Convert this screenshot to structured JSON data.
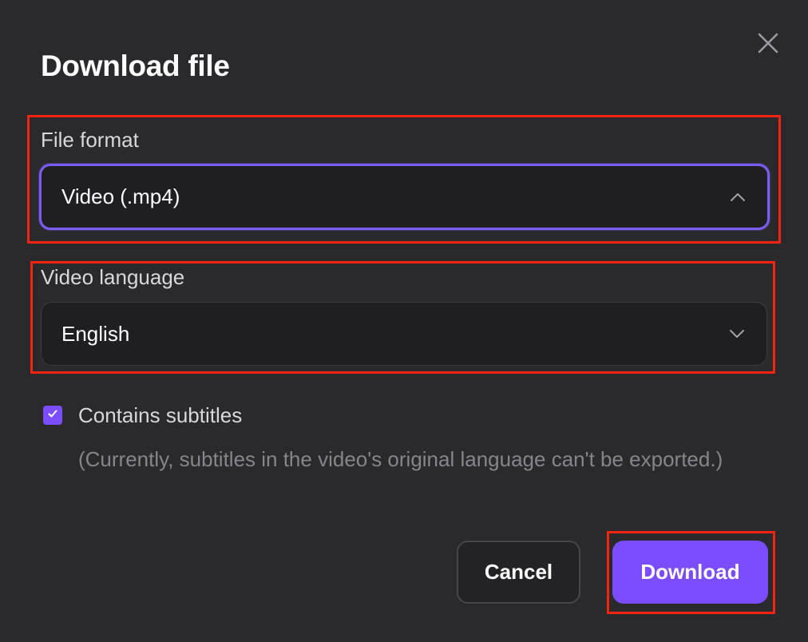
{
  "dialog": {
    "title": "Download file",
    "close_icon": "close-icon"
  },
  "file_format": {
    "label": "File format",
    "value": "Video (.mp4)",
    "icon": "chevron-up-icon",
    "expanded": true
  },
  "video_language": {
    "label": "Video language",
    "value": "English",
    "icon": "chevron-down-icon"
  },
  "subtitles": {
    "label": "Contains subtitles",
    "checked": true,
    "note": "(Currently, subtitles in the video's original language can't be exported.)"
  },
  "actions": {
    "cancel_label": "Cancel",
    "download_label": "Download"
  },
  "colors": {
    "background": "#2a2a2d",
    "accent": "#7c4dff",
    "highlight": "#f0240f"
  }
}
